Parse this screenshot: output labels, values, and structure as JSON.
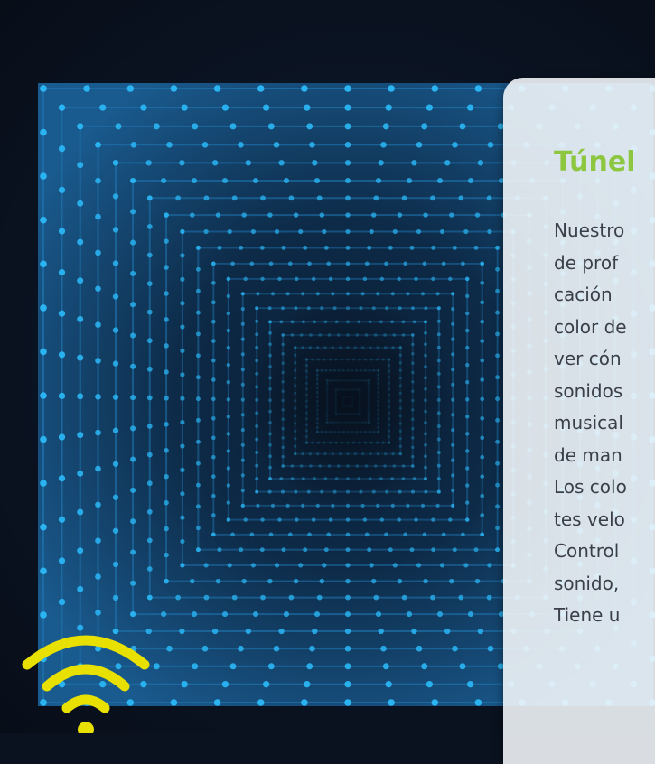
{
  "card": {
    "title": "Túnel",
    "lines": [
      "Nuestro",
      "de prof",
      "cación",
      "color de",
      "ver cón",
      "sonidos",
      "musical",
      "de man",
      "Los colo",
      "tes velo",
      "Control",
      "sonido,",
      "Tiene u"
    ]
  },
  "colors": {
    "title": "#8dc63f",
    "body_text": "#3a3f4a",
    "led": "#2ab4f2",
    "wifi": "#e8e000"
  },
  "icons": {
    "wifi": "wifi-icon"
  }
}
